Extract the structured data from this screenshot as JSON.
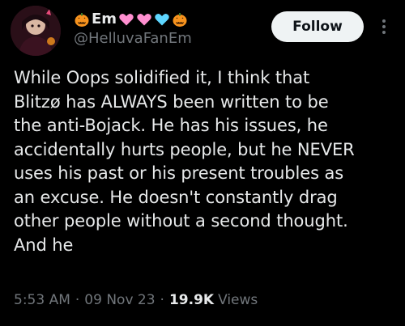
{
  "author": {
    "display_name": "Em",
    "handle": "@HelluvaFanEm",
    "name_emojis_before": [
      "jack-o-lantern"
    ],
    "name_emojis_after": [
      "pink-heart",
      "pink-heart",
      "light-blue-heart",
      "jack-o-lantern"
    ]
  },
  "follow_button": {
    "label": "Follow"
  },
  "tweet": {
    "text": "While Oops solidified it, I think that\nBlitzø has ALWAYS been written to be\nthe anti-Bojack. He has his issues, he\naccidentally hurts people, but he NEVER\nuses his past or his present troubles as\nan excuse. He doesn't constantly drag\nother people without a second thought.\nAnd he"
  },
  "meta": {
    "time": "5:53 AM",
    "date": "09 Nov 23",
    "views_count": "19.9K",
    "views_label": "Views",
    "separator": "·"
  },
  "colors": {
    "background": "#000000",
    "primary_text": "#e7e9ea",
    "secondary_text": "#71767b",
    "follow_button_bg": "#eff3f4",
    "follow_button_text": "#0f1419",
    "pink_heart": "#ff8fd0",
    "light_blue_heart": "#5ed6ff",
    "pumpkin": "#f7931e"
  }
}
